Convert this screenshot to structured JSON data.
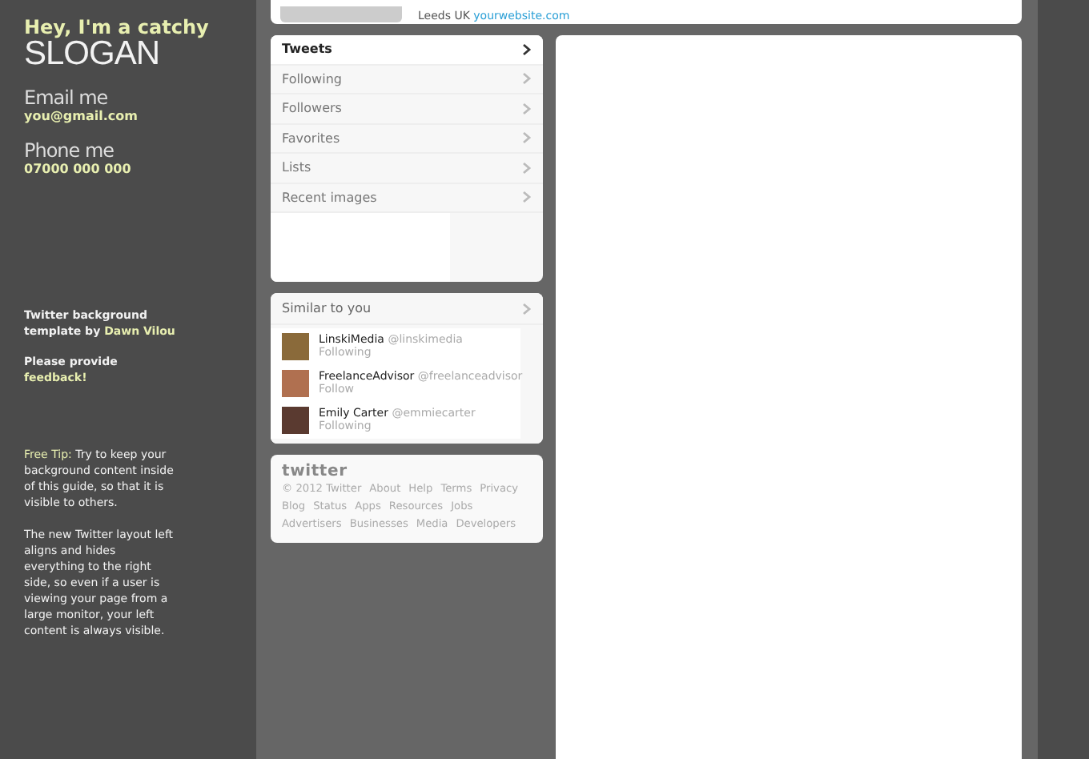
{
  "sidebar": {
    "slogan_top": "Hey, I'm a catchy",
    "slogan": "SLOGAN",
    "contacts": [
      {
        "label": "Email me",
        "value": "you@gmail.com"
      },
      {
        "label": "Phone me",
        "value": "07000 000 000"
      }
    ],
    "credit": {
      "text": "Twitter background template by ",
      "link": "Dawn Vilou"
    },
    "feedback": {
      "text": "Please provide ",
      "link": "feedback!"
    },
    "tip": {
      "label": "Free Tip:",
      "text": " Try to keep your background content inside of this guide, so that it is visible to others."
    },
    "note": "The new Twitter layout left aligns and hides everything to the right side, so even if a user is viewing your page from a large monitor, your left content is always visible."
  },
  "profile": {
    "location": "Leeds UK",
    "website": "yourwebsite.com"
  },
  "nav": [
    {
      "label": "Tweets",
      "selected": true
    },
    {
      "label": "Following",
      "selected": false
    },
    {
      "label": "Followers",
      "selected": false
    },
    {
      "label": "Favorites",
      "selected": false
    },
    {
      "label": "Lists",
      "selected": false
    },
    {
      "label": "Recent images",
      "selected": false
    }
  ],
  "similar": {
    "title": "Similar to you",
    "users": [
      {
        "name": "LinskiMedia",
        "handle": "@linskimedia",
        "status": "Following"
      },
      {
        "name": "FreelanceAdvisor",
        "handle": "@freelanceadvisor",
        "status": "Follow"
      },
      {
        "name": "Emily Carter",
        "handle": "@emmiecarter",
        "status": "Following"
      }
    ]
  },
  "footer": {
    "logo": "twitter",
    "links": [
      [
        "© 2012 Twitter",
        "About",
        "Help",
        "Terms",
        "Privacy"
      ],
      [
        "Blog",
        "Status",
        "Apps",
        "Resources",
        "Jobs"
      ],
      [
        "Advertisers",
        "Businesses",
        "Media",
        "Developers"
      ]
    ]
  }
}
